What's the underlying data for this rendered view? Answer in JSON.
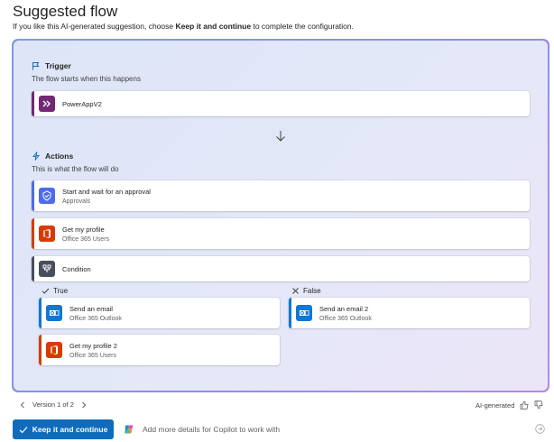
{
  "header": {
    "title": "Suggested flow",
    "subtitle_pre": "If you like this AI-generated suggestion, choose ",
    "subtitle_bold": "Keep it and continue",
    "subtitle_post": " to complete the configuration."
  },
  "trigger": {
    "heading": "Trigger",
    "description": "The flow starts when this happens",
    "card": {
      "name": "PowerAppV2",
      "icon": "powerapps-icon",
      "color": "#742774"
    }
  },
  "actions": {
    "heading": "Actions",
    "description": "This is what the flow will do",
    "cards": [
      {
        "name": "Start and wait for an approval",
        "connector": "Approvals",
        "icon": "approvals-icon",
        "color": "#4f6bed"
      },
      {
        "name": "Get my profile",
        "connector": "Office 365 Users",
        "icon": "office365-icon",
        "color": "#d83b01"
      },
      {
        "name": "Condition",
        "connector": "",
        "icon": "condition-icon",
        "color": "#484f5c"
      }
    ]
  },
  "branches": {
    "true": {
      "label": "True",
      "cards": [
        {
          "name": "Send an email",
          "connector": "Office 365 Outlook",
          "icon": "outlook-icon",
          "color": "#0f78d4"
        },
        {
          "name": "Get my profile 2",
          "connector": "Office 365 Users",
          "icon": "office365-icon",
          "color": "#d83b01"
        }
      ]
    },
    "false": {
      "label": "False",
      "cards": [
        {
          "name": "Send an email 2",
          "connector": "Office 365 Outlook",
          "icon": "outlook-icon",
          "color": "#0f78d4"
        }
      ]
    }
  },
  "footer": {
    "version": "Version 1 of 2",
    "ai_generated": "AI-generated"
  },
  "actions_bar": {
    "keep_button": "Keep it and continue",
    "copilot_placeholder": "Add more details for Copilot to work with"
  },
  "colors": {
    "accent": "#0f6cbd"
  }
}
